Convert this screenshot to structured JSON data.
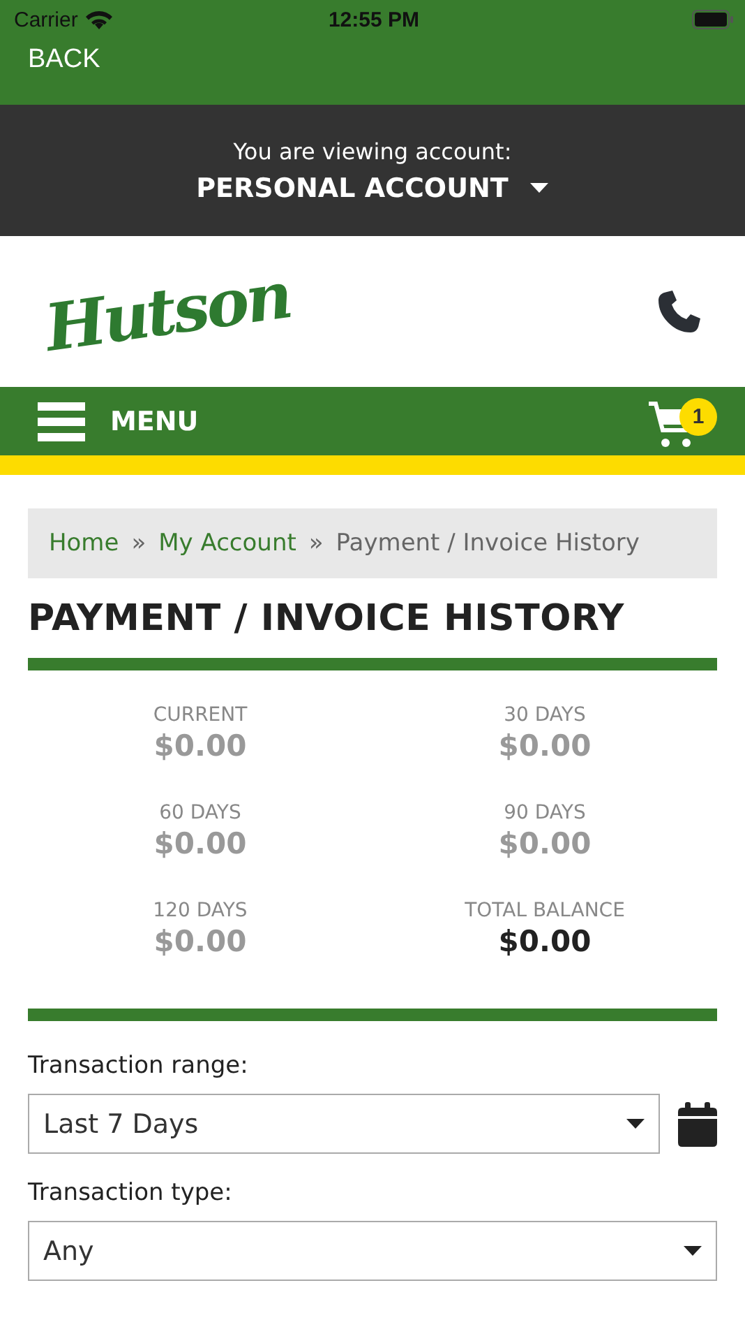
{
  "status_bar": {
    "carrier": "Carrier",
    "time": "12:55 PM"
  },
  "nav": {
    "back": "BACK"
  },
  "account": {
    "prompt": "You are viewing account:",
    "name": "PERSONAL ACCOUNT"
  },
  "header": {
    "logo": "Hutson"
  },
  "menu_bar": {
    "label": "MENU",
    "cart_count": "1"
  },
  "breadcrumb": [
    "Home",
    "My Account",
    "Payment / Invoice History"
  ],
  "breadcrumb_separator": "»",
  "title": "PAYMENT / INVOICE HISTORY",
  "balances": [
    {
      "label": "CURRENT",
      "amount": "$0.00",
      "emphasis": false
    },
    {
      "label": "30 DAYS",
      "amount": "$0.00",
      "emphasis": false
    },
    {
      "label": "60 DAYS",
      "amount": "$0.00",
      "emphasis": false
    },
    {
      "label": "90 DAYS",
      "amount": "$0.00",
      "emphasis": false
    },
    {
      "label": "120 DAYS",
      "amount": "$0.00",
      "emphasis": false
    },
    {
      "label": "TOTAL BALANCE",
      "amount": "$0.00",
      "emphasis": true
    }
  ],
  "filters": [
    {
      "label": "Transaction range:",
      "value": "Last 7 Days",
      "calendar": true
    },
    {
      "label": "Transaction type:",
      "value": "Any",
      "calendar": false
    }
  ]
}
